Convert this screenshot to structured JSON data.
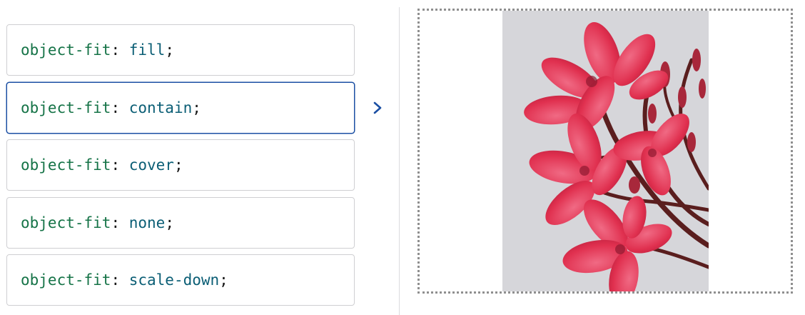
{
  "options": [
    {
      "property": "object-fit",
      "separator": ": ",
      "value": "fill",
      "terminator": ";"
    },
    {
      "property": "object-fit",
      "separator": ": ",
      "value": "contain",
      "terminator": ";"
    },
    {
      "property": "object-fit",
      "separator": ": ",
      "value": "cover",
      "terminator": ";"
    },
    {
      "property": "object-fit",
      "separator": ": ",
      "value": "none",
      "terminator": ";"
    },
    {
      "property": "object-fit",
      "separator": ": ",
      "value": "scale-down",
      "terminator": ";"
    }
  ],
  "selected_index": 1,
  "colors": {
    "property": "#157347",
    "value": "#0b5e75",
    "selected_border": "#1b4fa3",
    "chevron": "#1b4fa3"
  },
  "icons": {
    "chevron": "chevron-right-icon"
  }
}
